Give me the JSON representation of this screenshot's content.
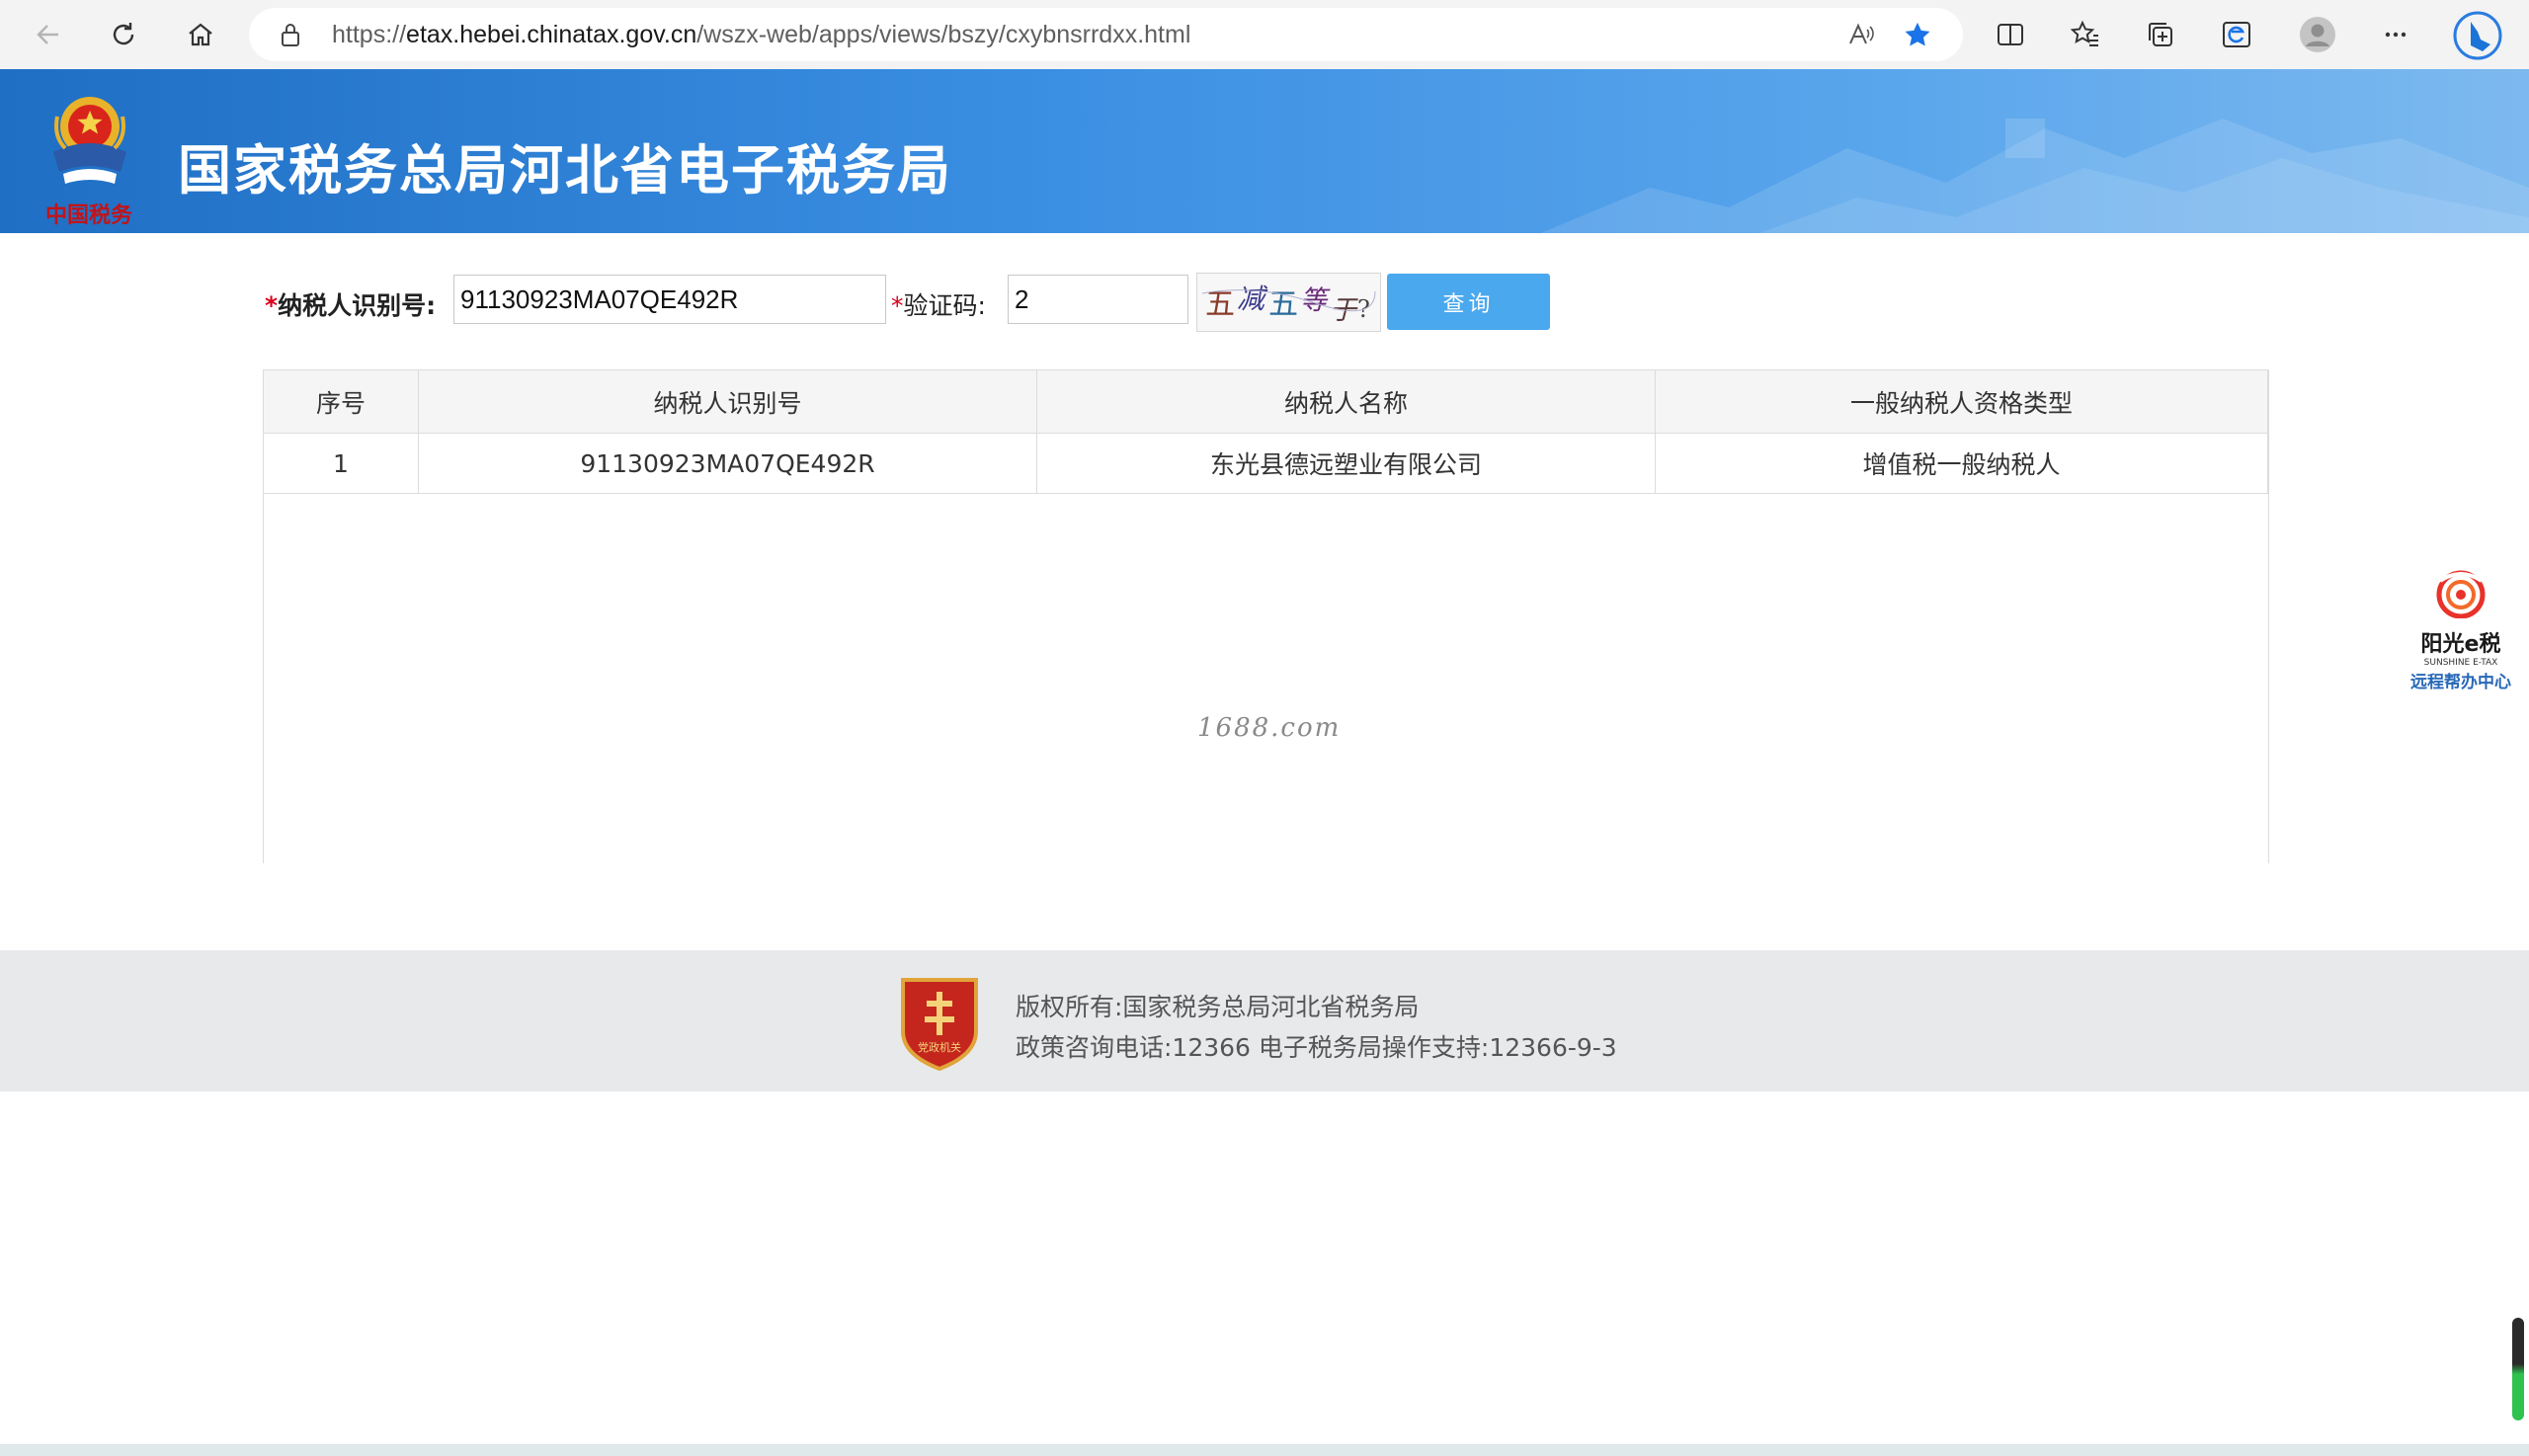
{
  "browser": {
    "url_prefix": "https://",
    "url_host": "etax.hebei.chinatax.gov.cn",
    "url_path": "/wszx-web/apps/views/bszy/cxybnsrrdxx.html"
  },
  "header": {
    "title": "国家税务总局河北省电子税务局",
    "emblem_caption": "中国税务"
  },
  "form": {
    "required_mark": "*",
    "taxpayer_id_label": "纳税人识别号:",
    "taxpayer_id_value": "91130923MA07QE492R",
    "captcha_label": "验证码:",
    "captcha_value": "2",
    "captcha_text": "五减五等于?",
    "query_button": "查询"
  },
  "table": {
    "columns": [
      "序号",
      "纳税人识别号",
      "纳税人名称",
      "一般纳税人资格类型"
    ],
    "rows": [
      [
        "1",
        "91130923MA07QE492R",
        "东光县德远塑业有限公司",
        "增值税一般纳税人"
      ]
    ]
  },
  "watermark": "1688.com",
  "side_widget": {
    "title": "阳光e税",
    "english": "SUNSHINE E-TAX",
    "subtitle": "远程帮办中心"
  },
  "footer": {
    "copyright": "版权所有:国家税务总局河北省税务局",
    "contact": "政策咨询电话:12366 电子税务局操作支持:12366-9-3",
    "badge_text": "党政机关"
  },
  "colors": {
    "banner_start": "#1f6fc4",
    "banner_end": "#7db9ef",
    "button": "#4aa8ee",
    "required": "#d9001b"
  }
}
